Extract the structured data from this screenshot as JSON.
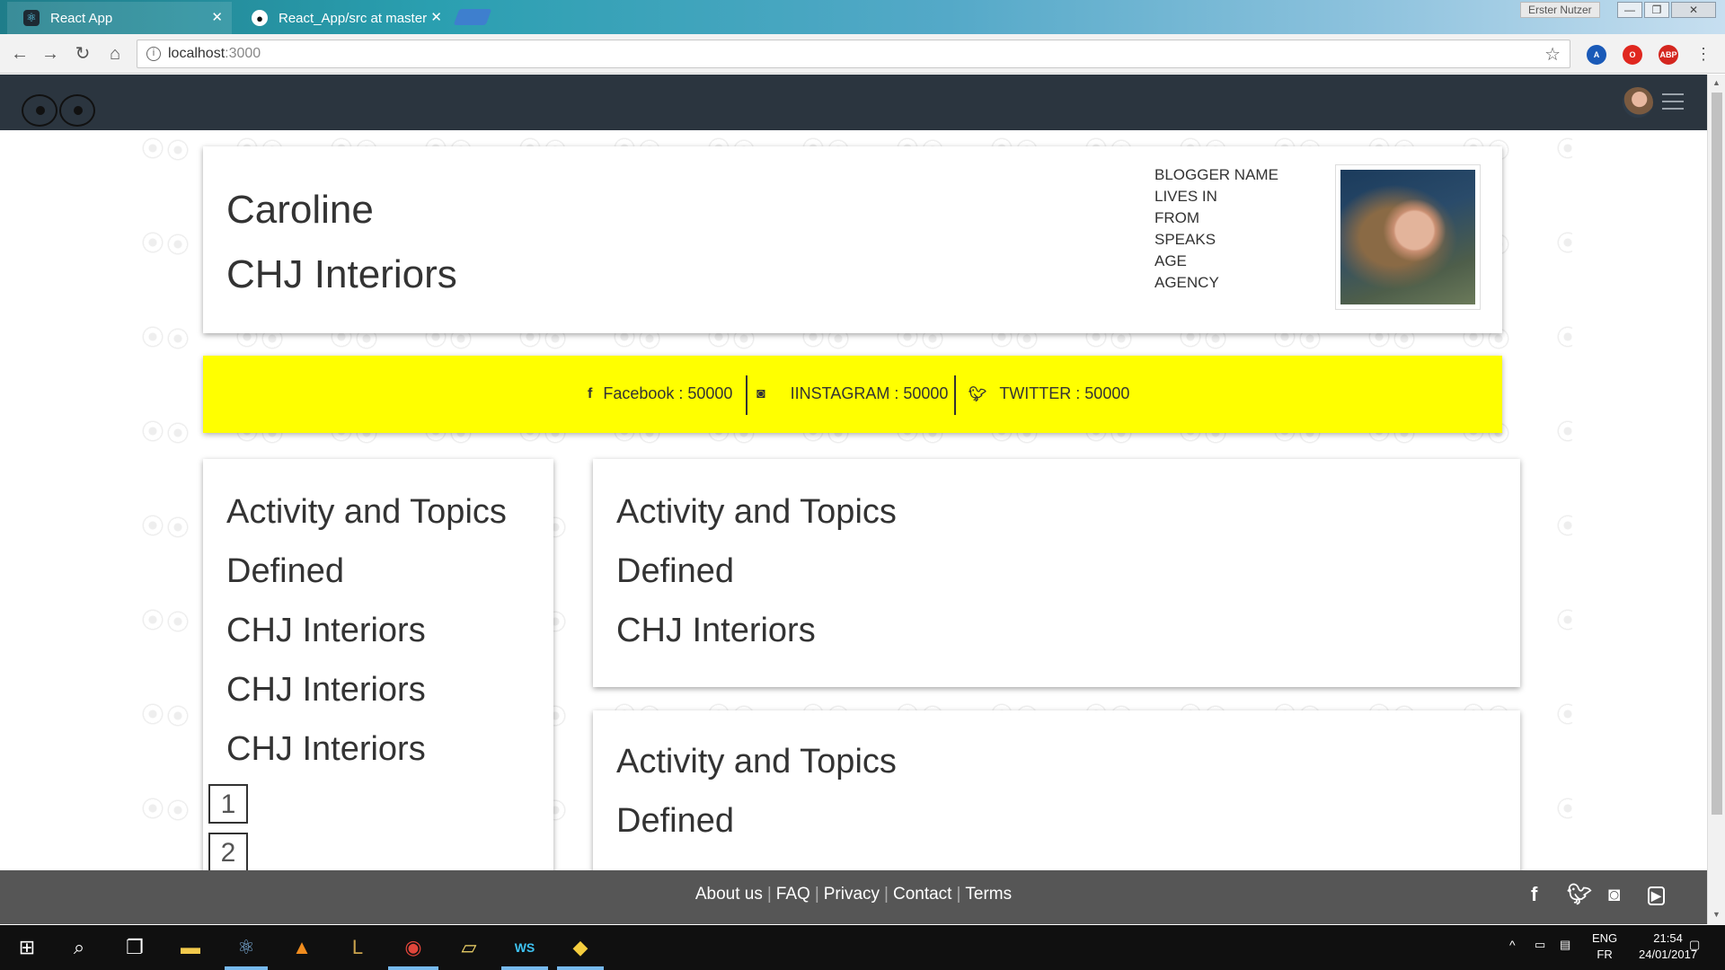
{
  "browser": {
    "tabs": [
      {
        "title": "React App"
      },
      {
        "title": "React_App/src at master"
      }
    ],
    "user_label": "Erster Nutzer",
    "url_host": "localhost",
    "url_port": ":3000"
  },
  "profile": {
    "name": "Caroline",
    "company": "CHJ Interiors",
    "fields": [
      "BLOGGER NAME",
      "LIVES IN",
      "FROM",
      "SPEAKS",
      "AGE",
      "AGENCY"
    ]
  },
  "social": {
    "facebook": "Facebook : 50000",
    "instagram": "IINSTAGRAM : 50000",
    "twitter": "TWITTER : 50000",
    "bar_color": "#ffff00"
  },
  "activity_list": {
    "items": [
      "Activity and Topics",
      "Defined",
      "CHJ Interiors",
      "CHJ Interiors",
      "CHJ Interiors"
    ],
    "pages": [
      "1",
      "2"
    ]
  },
  "right_card1": {
    "items": [
      "Activity and Topics",
      "Defined",
      "CHJ Interiors"
    ]
  },
  "right_card2": {
    "items": [
      "Activity and Topics",
      "Defined"
    ]
  },
  "footer": {
    "links": [
      "About us",
      "FAQ",
      "Privacy",
      "Contact",
      "Terms"
    ],
    "social_icons": [
      "facebook-icon",
      "twitter-icon",
      "instagram-icon",
      "youtube-icon"
    ]
  },
  "taskbar": {
    "lang_top": "ENG",
    "lang_bottom": "FR",
    "time": "21:54",
    "date": "24/01/2017"
  }
}
